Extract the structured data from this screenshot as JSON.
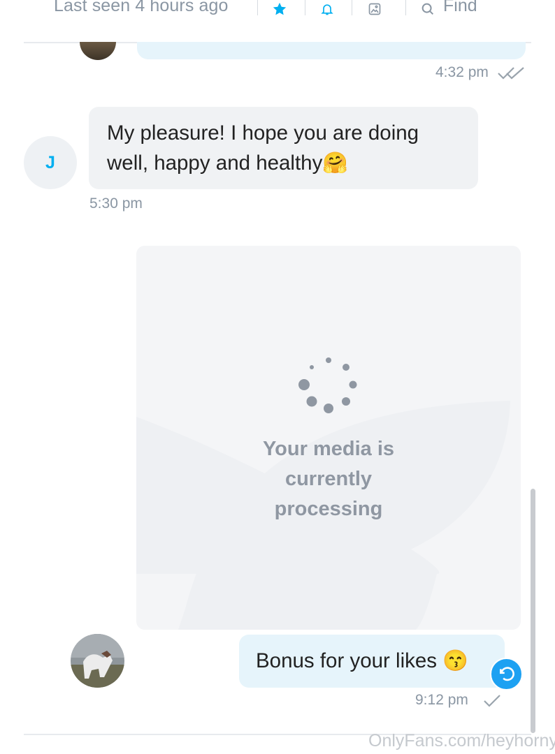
{
  "header": {
    "status": "Last seen 4 hours ago",
    "find_label": "Find",
    "icons": [
      "star-icon",
      "bell-icon",
      "image-icon",
      "search-icon"
    ],
    "accent_color": "#00aff0"
  },
  "messages": [
    {
      "direction": "outgoing",
      "time": "4:32 pm",
      "read_receipt": "double-check-icon"
    },
    {
      "direction": "incoming",
      "avatar_letter": "J",
      "text": "My pleasure! I hope you are doing well, happy and healthy🤗",
      "time": "5:30 pm"
    },
    {
      "direction": "outgoing",
      "type": "media",
      "processing_text": "Your media is currently processing"
    },
    {
      "direction": "outgoing",
      "text": "Bonus for your likes 😙",
      "time": "9:12 pm",
      "read_receipt": "check-icon"
    }
  ],
  "watermark": "OnlyFans.com/heyhorny"
}
